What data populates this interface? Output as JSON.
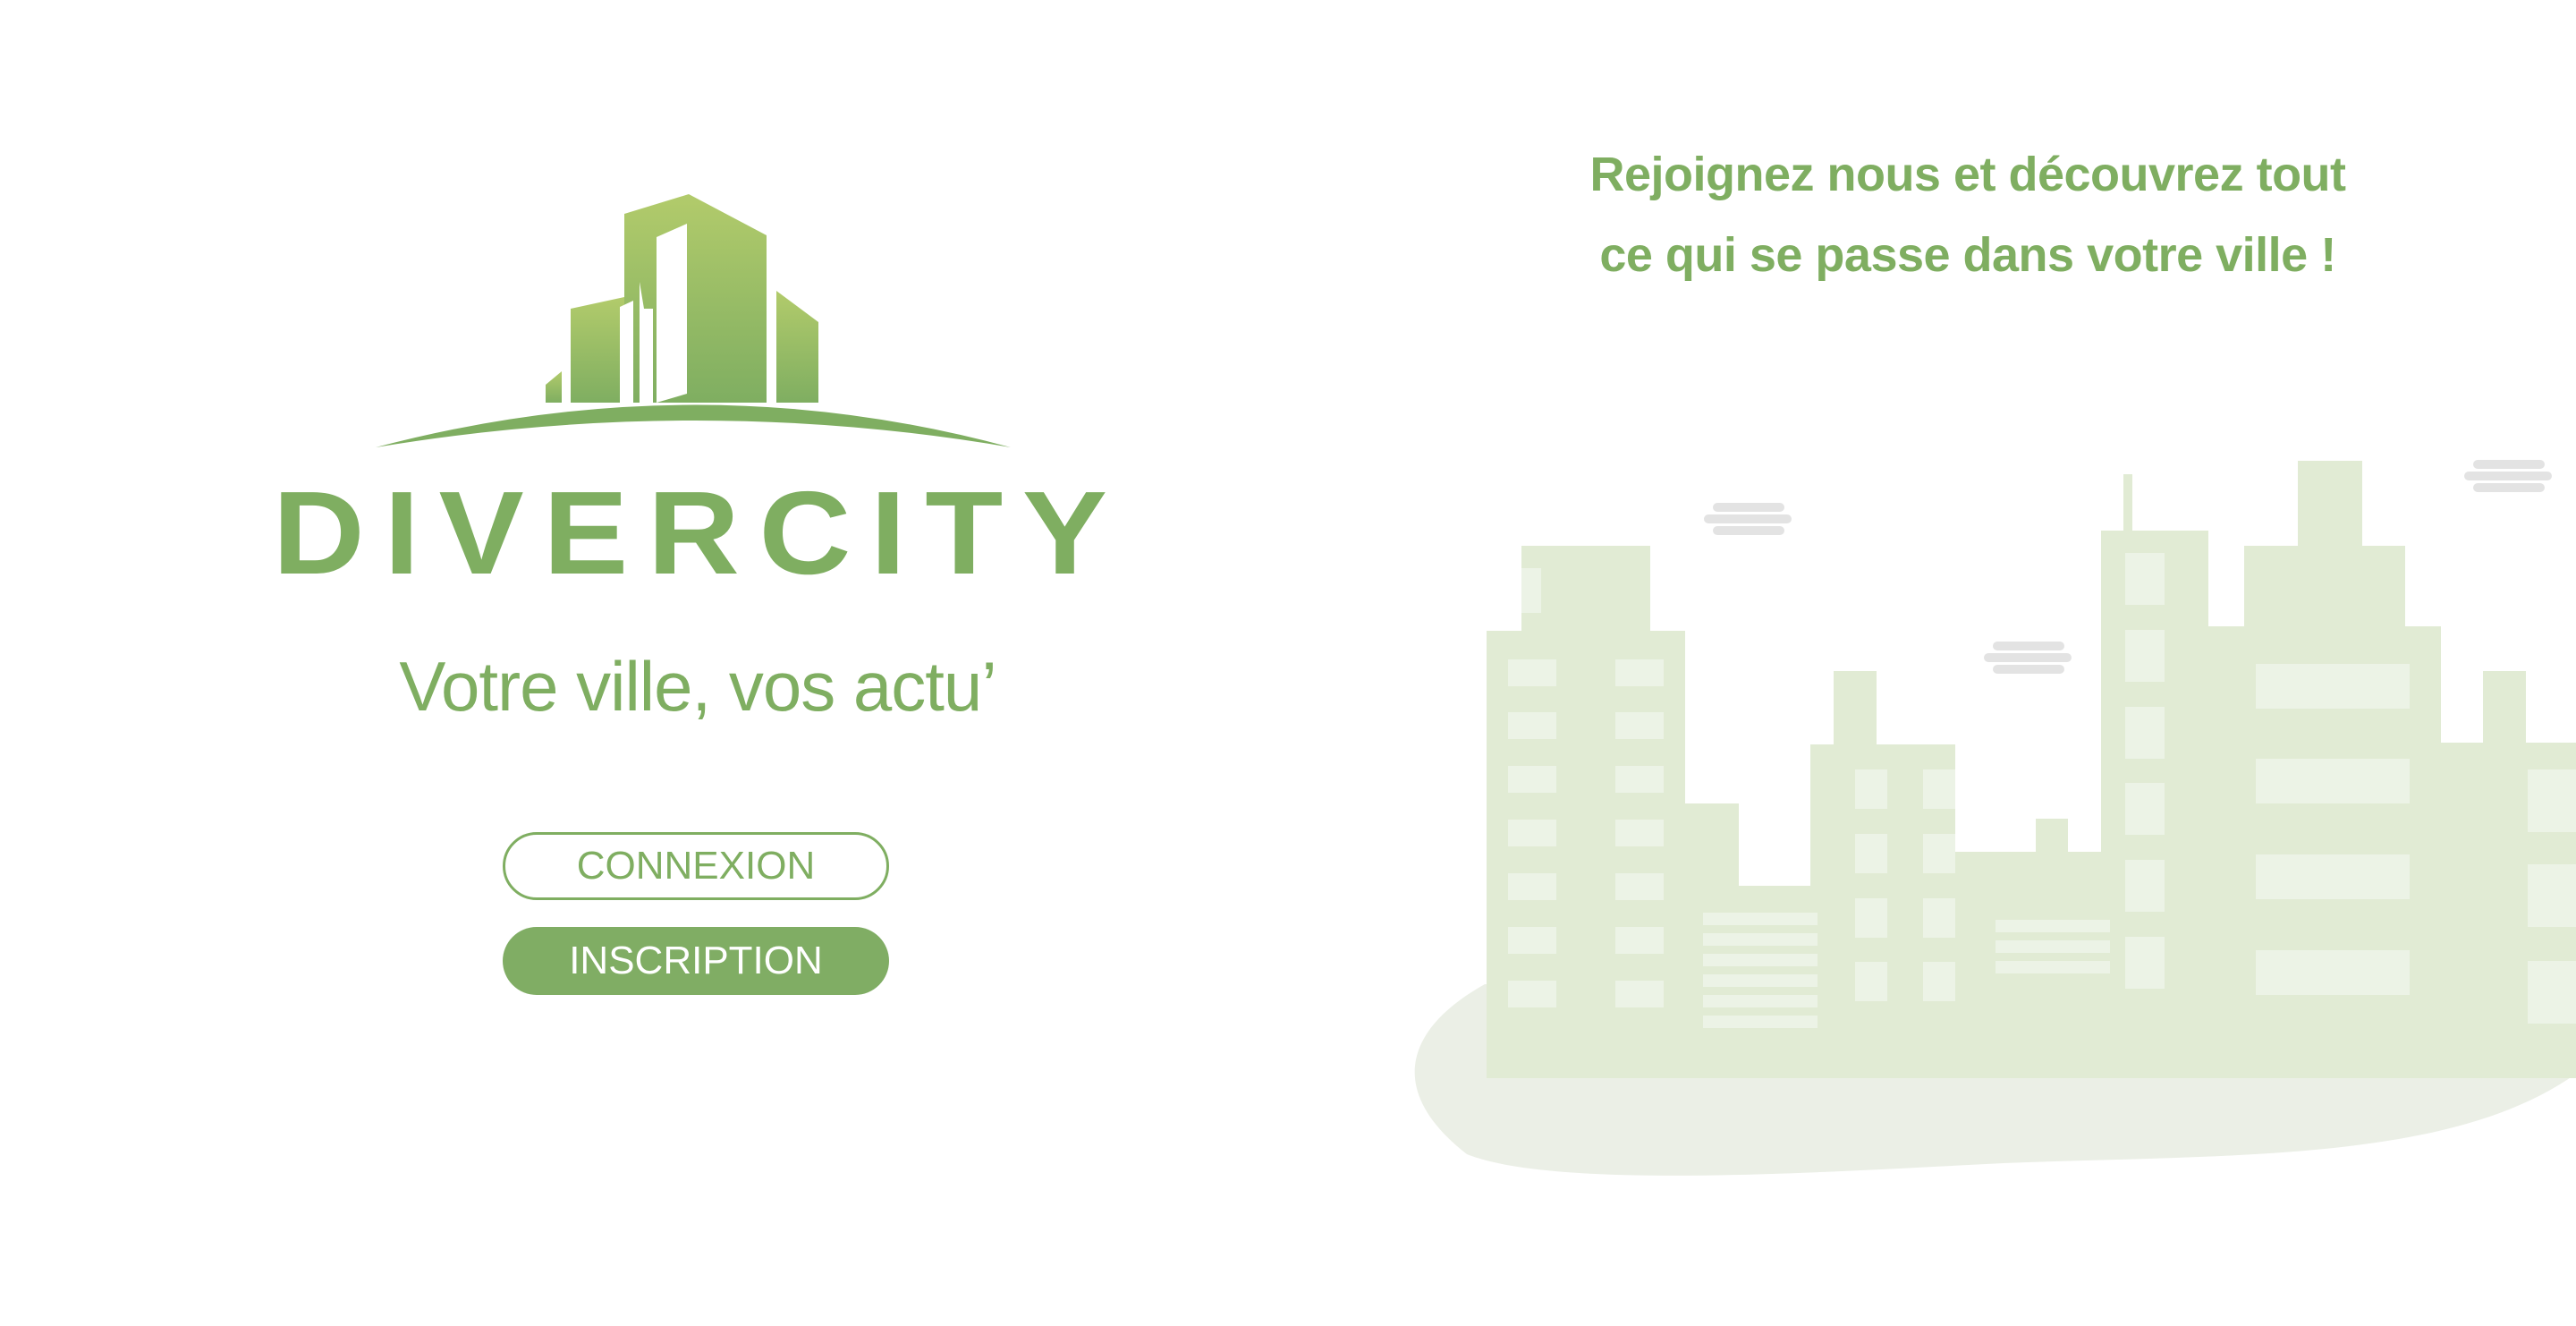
{
  "brand": {
    "name": "DIVERCITY",
    "tagline": "Votre ville, vos actu’"
  },
  "auth": {
    "login_label": "CONNEXION",
    "signup_label": "INSCRIPTION"
  },
  "promo": {
    "line1": "Rejoignez nous et découvrez tout",
    "line2": "ce qui se passe dans votre ville !"
  },
  "colors": {
    "brand_green": "#7fae61",
    "light_green": "#b0ca6a",
    "city_fill": "#e1ebd4",
    "window_fill": "#ecf3e6",
    "ground_fill": "#ebefe6",
    "cloud_fill": "#e3e3e3"
  },
  "icons": {
    "logo": "city-skyline-logo-icon",
    "illustration": "city-skyline-illustration"
  }
}
